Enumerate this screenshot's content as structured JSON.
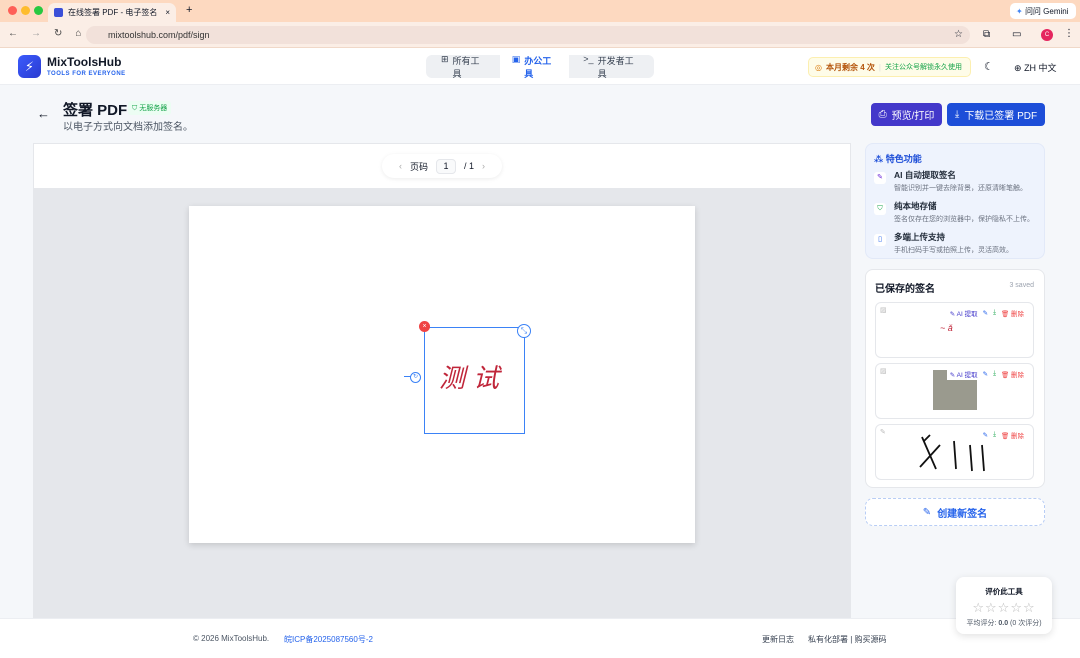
{
  "browser": {
    "tab_title": "在线签署 PDF - 电子签名",
    "url": "mixtoolshub.com/pdf/sign",
    "gemini": "问问 Gemini",
    "profile": "C"
  },
  "brand": {
    "name": "MixToolsHub",
    "tagline": "TOOLS FOR EVERYONE"
  },
  "nav": [
    {
      "label": "所有工具",
      "icon": "grid-icon"
    },
    {
      "label": "办公工具",
      "icon": "briefcase-icon",
      "active": true
    },
    {
      "label": "开发者工具",
      "icon": "terminal-icon"
    }
  ],
  "quota": {
    "remaining": "本月剩余 4 次",
    "promo": "关注公众号解锁永久使用"
  },
  "lang": "ZH 中文",
  "page": {
    "title": "签署 PDF",
    "badge": "无服务器",
    "subtitle": "以电子方式向文档添加签名。"
  },
  "actions": {
    "preview": "预览/打印",
    "download": "下载已签署 PDF"
  },
  "pager": {
    "label": "页码",
    "current": "1",
    "total": "/ 1"
  },
  "signature_text": "测试",
  "features": {
    "title": "特色功能",
    "items": [
      {
        "title": "AI 自动提取签名",
        "desc": "智能识别并一键去除背景，还原清晰笔触。"
      },
      {
        "title": "纯本地存储",
        "desc": "签名仅存在您的浏览器中，保护隐私不上传。"
      },
      {
        "title": "多端上传支持",
        "desc": "手机扫码手写或拍照上传，灵活高效。"
      }
    ]
  },
  "saved": {
    "title": "已保存的签名",
    "count": "3 saved",
    "ai_label": "AI 提取",
    "delete_label": "删除"
  },
  "create_label": "创建新签名",
  "footer": {
    "copyright": "© 2026 MixToolsHub.",
    "icp": "皖ICP备2025087560号-2",
    "changelog": "更新日志",
    "private": "私有化部署 | 购买源码"
  },
  "rating": {
    "title": "评价此工具",
    "stars": 5,
    "filled": 0,
    "avg_label": "平均评分:",
    "avg": "0.0",
    "count": "(0 次评分)"
  },
  "colors": {
    "primary": "#2563eb",
    "indigo": "#4338ca",
    "danger": "#ef4444",
    "success": "#16a34a"
  }
}
